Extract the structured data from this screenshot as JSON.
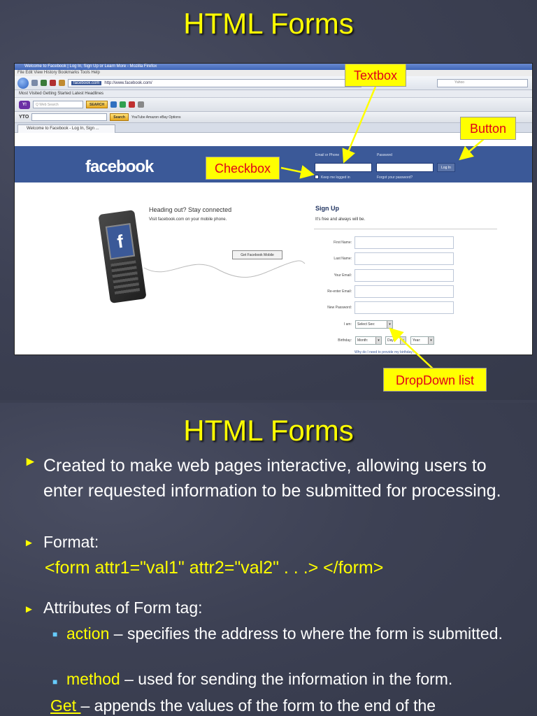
{
  "slide1": {
    "title": "HTML Forms",
    "browser": {
      "window_title": "Welcome to Facebook | Log In, Sign Up or Learn More - Mozilla Firefox",
      "menu": "File  Edit  View  History  Bookmarks  Tools  Help",
      "url_site": "facebook.com",
      "url": "http://www.facebook.com/",
      "search_engine": "Yahoo",
      "bookmarks": "Most Visited   Getting Started   Latest Headlines",
      "yahoo_logo": "Y!",
      "yahoo_search_placeholder": "Q  Web Search",
      "yahoo_search_btn": "SEARCH",
      "yto_label": "YTO",
      "yto_search_btn": "Search",
      "yto_links": "YouTube   Amazon   eBay   Options",
      "tab_label": "Welcome to Facebook - Log In, Sign ..."
    },
    "facebook": {
      "logo": "facebook",
      "email_label": "Email or Phone",
      "password_label": "Password",
      "login_button": "Log In",
      "keep_logged_in": "Keep me logged in",
      "forgot_password": "Forgot your password?",
      "heading": "Heading out? Stay connected",
      "subheading": "Visit facebook.com on your mobile phone.",
      "get_mobile_button": "Get Facebook Mobile",
      "signup_title": "Sign Up",
      "signup_subtitle": "It's free and always will be.",
      "fields": [
        "First Name:",
        "Last Name:",
        "Your Email:",
        "Re-enter Email:",
        "New Password:"
      ],
      "i_am_label": "I am:",
      "select_sex": "Select Sex:",
      "birthday_label": "Birthday:",
      "month": "Month:",
      "day": "Day:",
      "year": "Year:",
      "why_birthday": "Why do I need to provide my birthday?"
    },
    "callouts": {
      "textbox": "Textbox",
      "button": "Button",
      "checkbox": "Checkbox",
      "dropdown": "DropDown list"
    }
  },
  "slide2": {
    "title": "HTML Forms",
    "bullet1": "Created to make web pages interactive, allowing users to enter requested information to be submitted for processing.",
    "bullet2": "Format:",
    "format_code": "<form attr1=\"val1\" attr2=\"val2\" . . .> </form>",
    "bullet3": "Attributes of Form tag:",
    "sub1_keyword": "action",
    "sub1_text": " – specifies the address to where the form is submitted.",
    "sub2_keyword": "method",
    "sub2_text": " – used for sending the information in the form.",
    "get_keyword": "Get ",
    "get_text": "– appends the values of the form to the end of the"
  },
  "colors": {
    "background": "#3b3f51",
    "title_yellow": "#ffff00",
    "callout_text": "#e0001a",
    "facebook_blue": "#3b5998",
    "sub_bullet": "#66ccff"
  }
}
